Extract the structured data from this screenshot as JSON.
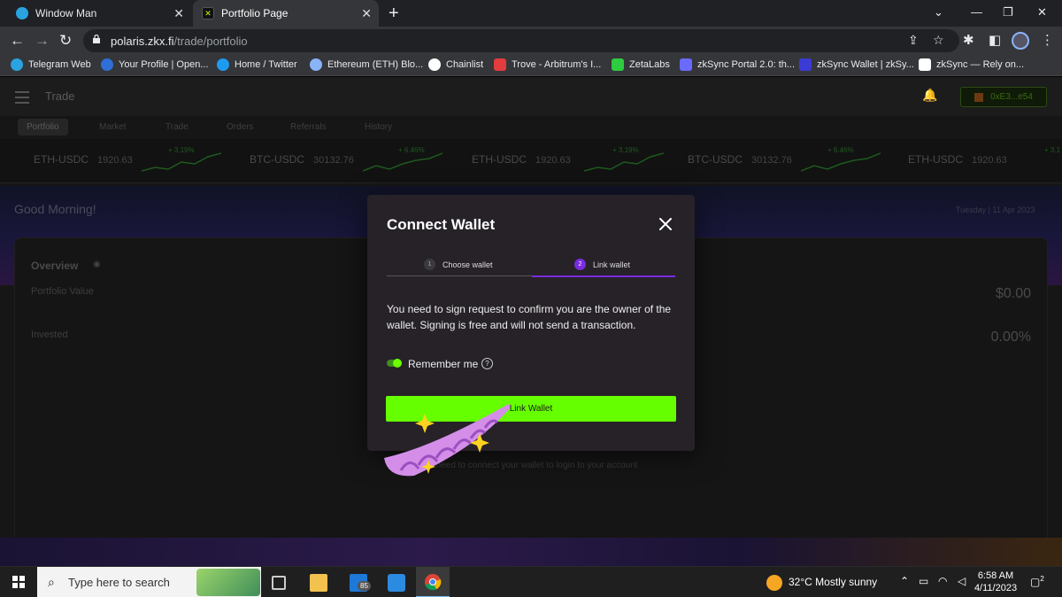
{
  "browser": {
    "tabs": [
      {
        "title": "Window Man",
        "icon": "telegram-icon"
      },
      {
        "title": "Portfolio Page",
        "icon": "polaris-icon"
      }
    ],
    "new_tab_symbol": "+",
    "url_host": "polaris.zkx.fi",
    "url_path": "/trade/portfolio",
    "bookmarks": [
      {
        "label": "Telegram Web",
        "color": "#2aa3e0"
      },
      {
        "label": "Your Profile | Open...",
        "color": "#2f6fd6"
      },
      {
        "label": "Home / Twitter",
        "color": "#1d9bf0"
      },
      {
        "label": "Ethereum (ETH) Blo...",
        "color": "#8ab4f8"
      },
      {
        "label": "Chainlist",
        "color": "#ffffff"
      },
      {
        "label": "Trove - Arbitrum's I...",
        "color": "#e23c3c"
      },
      {
        "label": "ZetaLabs",
        "color": "#2ecc40"
      },
      {
        "label": "zkSync Portal 2.0: th...",
        "color": "#6a6aff"
      },
      {
        "label": "zkSync Wallet | zkSy...",
        "color": "#3b3bd6"
      },
      {
        "label": "zkSync — Rely on...",
        "color": "#ffffff"
      }
    ]
  },
  "app": {
    "nav_title": "Trade",
    "wallet_address": "0xE3...e54",
    "tabs": [
      "Portfolio",
      "Market",
      "Trade",
      "Orders",
      "Referrals",
      "History"
    ],
    "ticker": [
      {
        "pair": "ETH-USDC",
        "price": "1920.63",
        "change": "+ 3.19%"
      },
      {
        "pair": "BTC-USDC",
        "price": "30132.76",
        "change": "+ 6.46%"
      },
      {
        "pair": "ETH-USDC",
        "price": "1920.63",
        "change": "+ 3.19%"
      },
      {
        "pair": "BTC-USDC",
        "price": "30132.76",
        "change": "+ 6.46%"
      },
      {
        "pair": "ETH-USDC",
        "price": "1920.63",
        "change": "+ 3.1"
      }
    ],
    "greeting": "Good Morning!",
    "date": "Tuesday | 11 Apr 2023",
    "overview": {
      "title": "Overview",
      "portfolio_label": "Portfolio Value",
      "portfolio_value": "$0.00",
      "invested_label": "Invested",
      "invested_value": "0.00%"
    },
    "connect_hint": "You need to connect your wallet to login to your account"
  },
  "modal": {
    "title": "Connect Wallet",
    "steps": [
      {
        "num": "1",
        "label": "Choose wallet"
      },
      {
        "num": "2",
        "label": "Link wallet"
      }
    ],
    "message": "You need to sign request to confirm you are the owner of the wallet. Signing is free and will not send a transaction.",
    "remember_label": "Remember me",
    "remember_on": true,
    "button_label": "Link Wallet",
    "button_color": "#66ff00",
    "accent_color": "#7a2ce0"
  },
  "taskbar": {
    "search_placeholder": "Type here to search",
    "mail_badge": "85",
    "weather": "32°C  Mostly sunny",
    "time": "6:58 AM",
    "date": "4/11/2023",
    "notifications": "2"
  }
}
